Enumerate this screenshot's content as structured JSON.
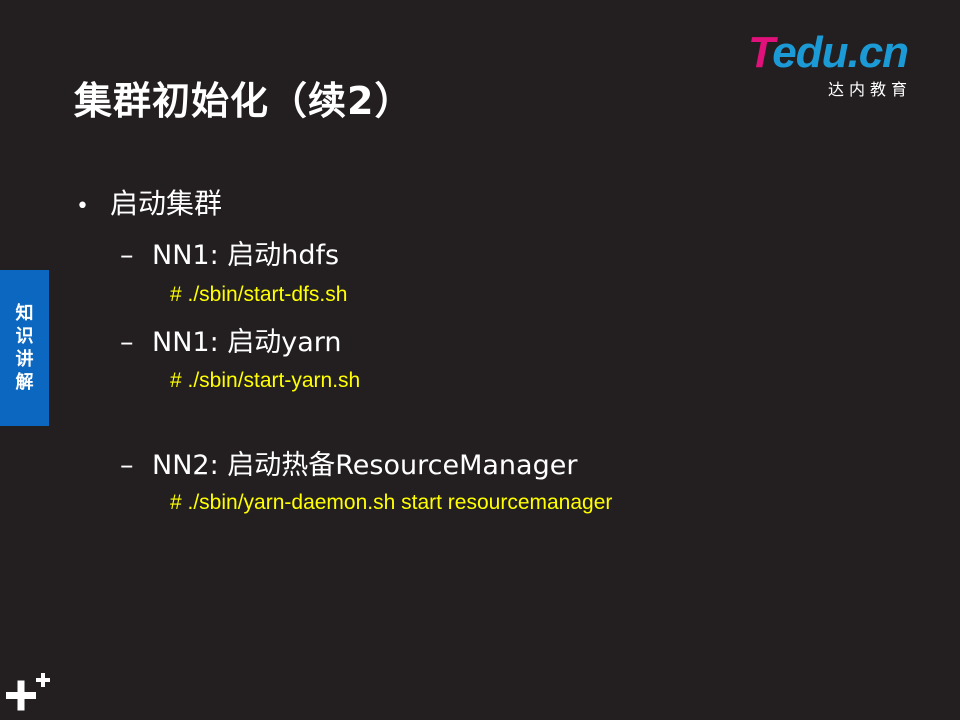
{
  "slide": {
    "title": "集群初始化（续2）",
    "logo": {
      "brand_t": "T",
      "brand_rest": "edu.cn",
      "subtitle": "达内教育"
    },
    "side_tab": "知识讲解",
    "bullet": "启动集群",
    "items": [
      {
        "label": "NN1:  启动hdfs",
        "command": "# ./sbin/start-dfs.sh"
      },
      {
        "label": "NN1: 启动yarn",
        "command": "# ./sbin/start-yarn.sh"
      },
      {
        "label": "NN2: 启动热备ResourceManager",
        "command": "# ./sbin/yarn-daemon.sh start resourcemanager"
      }
    ]
  },
  "colors": {
    "background": "#231f20",
    "command_text": "#ffff00",
    "side_tab": "#0b67c0",
    "logo_pink": "#e0117a",
    "logo_blue": "#1b9ad6"
  }
}
